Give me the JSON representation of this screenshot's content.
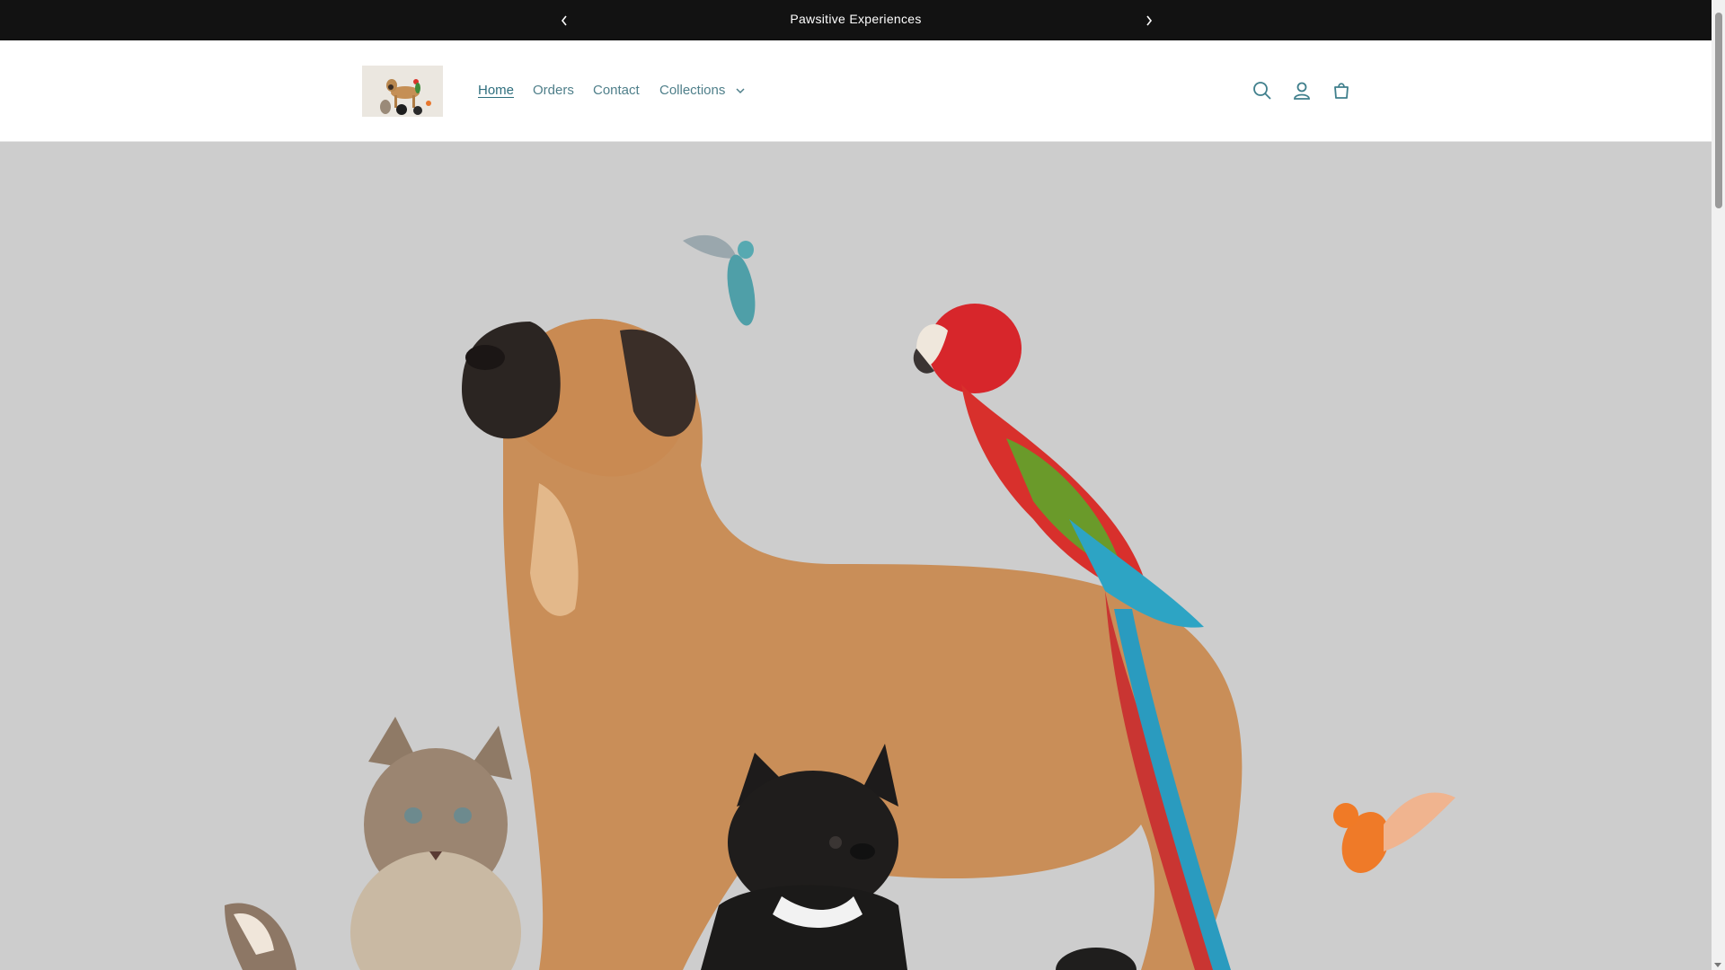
{
  "announcement": {
    "text": "Pawsitive Experiences",
    "prev_icon": "chevron-left-icon",
    "next_icon": "chevron-right-icon"
  },
  "header": {
    "logo_alt": "Store logo - dog and pets",
    "nav": [
      {
        "label": "Home",
        "active": true
      },
      {
        "label": "Orders",
        "active": false
      },
      {
        "label": "Contact",
        "active": false
      },
      {
        "label": "Collections",
        "active": false,
        "has_dropdown": true
      }
    ],
    "icons": [
      "search-icon",
      "account-icon",
      "cart-icon"
    ]
  },
  "hero": {
    "image_alt": "Group of pets: a large mastiff dog with a macaw parrot on its back, a cat, a french bulldog and small birds"
  },
  "colors": {
    "announcement_bg": "#121212",
    "nav_link": "#4f7f8a",
    "hero_bg": "#cdcdcd"
  }
}
